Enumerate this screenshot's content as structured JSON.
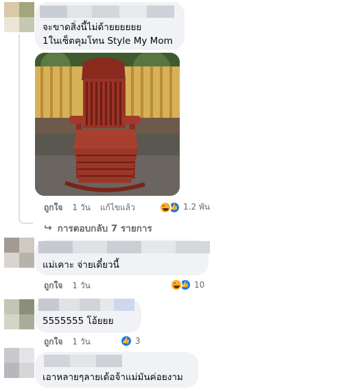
{
  "comments": [
    {
      "text_lines": [
        "จะขาดสิ่งนี้ไม่ด้ายยยยยย",
        "1ในเซ็ตคุมโทน Style My Mom"
      ],
      "actions": {
        "like": "ถูกใจ",
        "time": "1 วัน",
        "edited": "แก้ไขแล้ว"
      },
      "reaction_count": "1.2 พัน",
      "replies_label": "การตอบกลับ 7 รายการ"
    },
    {
      "text_lines": [
        "แม่เคาะ จ่ายเดี๋ยวนี้"
      ],
      "actions": {
        "like": "ถูกใจ",
        "time": "1 วัน"
      },
      "reaction_count": "10"
    },
    {
      "text_lines": [
        "5555555 โอ้ยยย"
      ],
      "actions": {
        "like": "ถูกใจ",
        "time": "1 วัน"
      },
      "reaction_count": "3"
    },
    {
      "text_lines": [
        "เอาหลายๆลายเด้อจ้าแม่มันค่อยงาม"
      ]
    }
  ],
  "icons": {
    "haha": "haha-reaction-icon",
    "like": "like-reaction-icon",
    "reply_arrow": "reply-arrow-icon"
  },
  "colors": {
    "bubble": "#f0f2f5",
    "like_blue": "#1877f2",
    "haha_yellow": "#f7b125",
    "secondary_text": "#65676b"
  }
}
